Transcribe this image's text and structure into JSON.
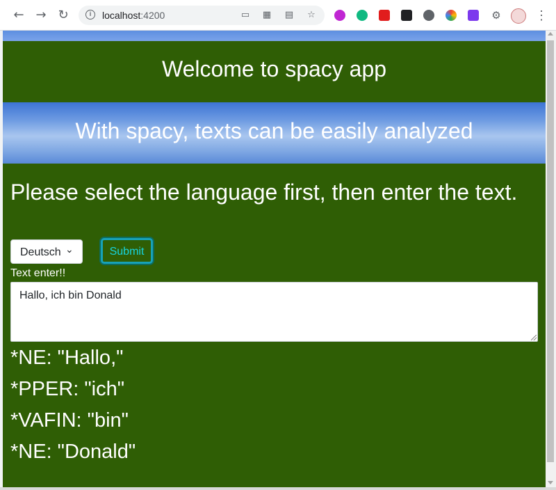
{
  "browser": {
    "url_host": "localhost",
    "url_port": ":4200",
    "icons": [
      "back-icon",
      "forward-icon",
      "reload-icon",
      "site-info-icon",
      "cast-icon",
      "qr-icon",
      "translate-icon",
      "bookmark-star-icon",
      "extensions-icon",
      "profile-avatar",
      "menu-icon"
    ]
  },
  "page": {
    "title": "Welcome to spacy app",
    "subtitle": "With spacy, texts can be easily analyzed",
    "prompt": "Please select the language first, then enter the text.",
    "language_selected": "Deutsch",
    "submit_label": "Submit",
    "text_label": "Text enter!!",
    "text_value": "Hallo, ich bin Donald",
    "results": [
      "*NE: \"Hallo,\"",
      "*PPER: \"ich\"",
      "*VAFIN: \"bin\"",
      "*NE: \"Donald\""
    ]
  },
  "colors": {
    "page_background": "#2f5e05",
    "submit_accent": "#17a2b8"
  }
}
